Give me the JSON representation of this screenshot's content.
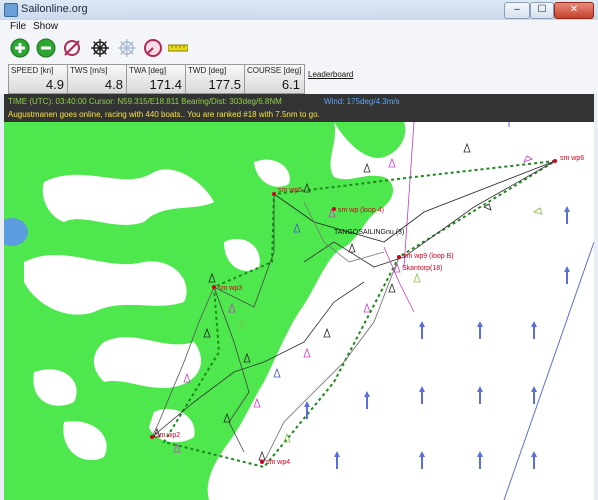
{
  "window": {
    "title": "Sailonline.org",
    "controls": [
      "–",
      "☐",
      "✕"
    ]
  },
  "menu": [
    {
      "label": "File"
    },
    {
      "label": "Show"
    }
  ],
  "toolbar": [
    {
      "icon": "zoom-in-icon",
      "color": "#2da531"
    },
    {
      "icon": "zoom-out-icon",
      "color": "#2da531"
    },
    {
      "icon": "crosshair-icon",
      "color": "#b0285a"
    },
    {
      "icon": "steering-wheel-icon",
      "color": "#222222"
    },
    {
      "icon": "compass-rose-icon",
      "color": "#aab9cf"
    },
    {
      "icon": "gauge-icon",
      "color": "#b0285a"
    },
    {
      "icon": "ruler-icon",
      "color": "#e6d81a"
    }
  ],
  "stats": [
    {
      "label": "SPEED [kn]",
      "value": "4.9"
    },
    {
      "label": "TWS [m/s]",
      "value": "4.8"
    },
    {
      "label": "TWA [deg]",
      "value": "171.4"
    },
    {
      "label": "TWD [deg]",
      "value": "177.5"
    },
    {
      "label": "COURSE [deg]",
      "value": "6.1"
    }
  ],
  "leaderboard": "Leaderboard",
  "info": {
    "line1": "TIME (UTC): 03:40:00   Cursor: N59.315/E18.811  Bearing/Dist: 303deg/6.8NM",
    "wind": "Wind: 175deg/4.3m/s",
    "line2": "Augustmanen goes online, racing with 440 boats.. You are ranked #18 with 7.5nm to go."
  },
  "map_labels": {
    "wp6": "sm wp6",
    "wp5": "sm wp5",
    "wp4_loop": "sm wp (loop 4)",
    "wp3": "sm wp3",
    "wp2": "sm wp2",
    "wp4": "sm wp4",
    "wp9": "sm wp9 (loop B)",
    "boat_tango": "TANGOSAILINGnu (3)",
    "boat_skantorp": "Skantorp(18)"
  },
  "colors": {
    "land": "#4ee84e",
    "water": "#ffffff",
    "route": "#1b8a1b",
    "mark": "#d2001e"
  }
}
